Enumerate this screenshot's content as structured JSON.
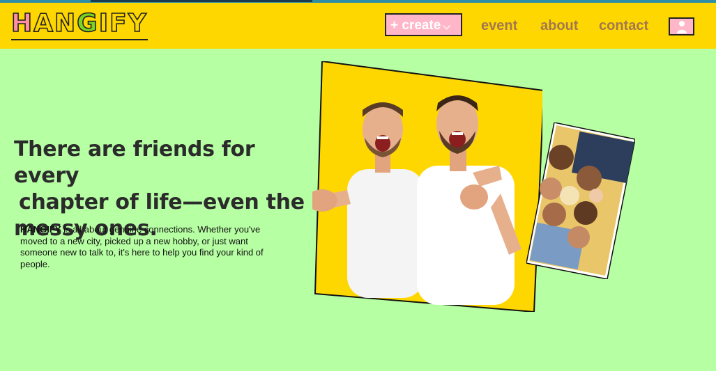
{
  "brand": {
    "logo_letters": [
      "H",
      "A",
      "N",
      "G",
      "I",
      "F",
      "Y"
    ],
    "logo_colors": [
      "#ff8fa3",
      "#ffd700",
      "#ffd700",
      "#7cd320",
      "#ffd700",
      "#ffd700",
      "#ffd700"
    ]
  },
  "nav": {
    "create_label": "+ create",
    "event_label": "event",
    "about_label": "about",
    "contact_label": "contact",
    "profile_icon": "user-icon"
  },
  "hero": {
    "headline_line1": "There are friends for every",
    "headline_line2": "chapter of life—even the",
    "headline_line3": "messy ones.",
    "desc_brand": "HANGIFY",
    "desc_text": " is all about genuine connections. Whether you've moved to a new city, picked up a new hobby, or just want someone new to talk to, it's here to help you find your kind of people."
  },
  "colors": {
    "background": "#b6ffa3",
    "header": "#ffd700",
    "accent_pink": "#ffb6c9",
    "nav_text": "#a3784f"
  }
}
